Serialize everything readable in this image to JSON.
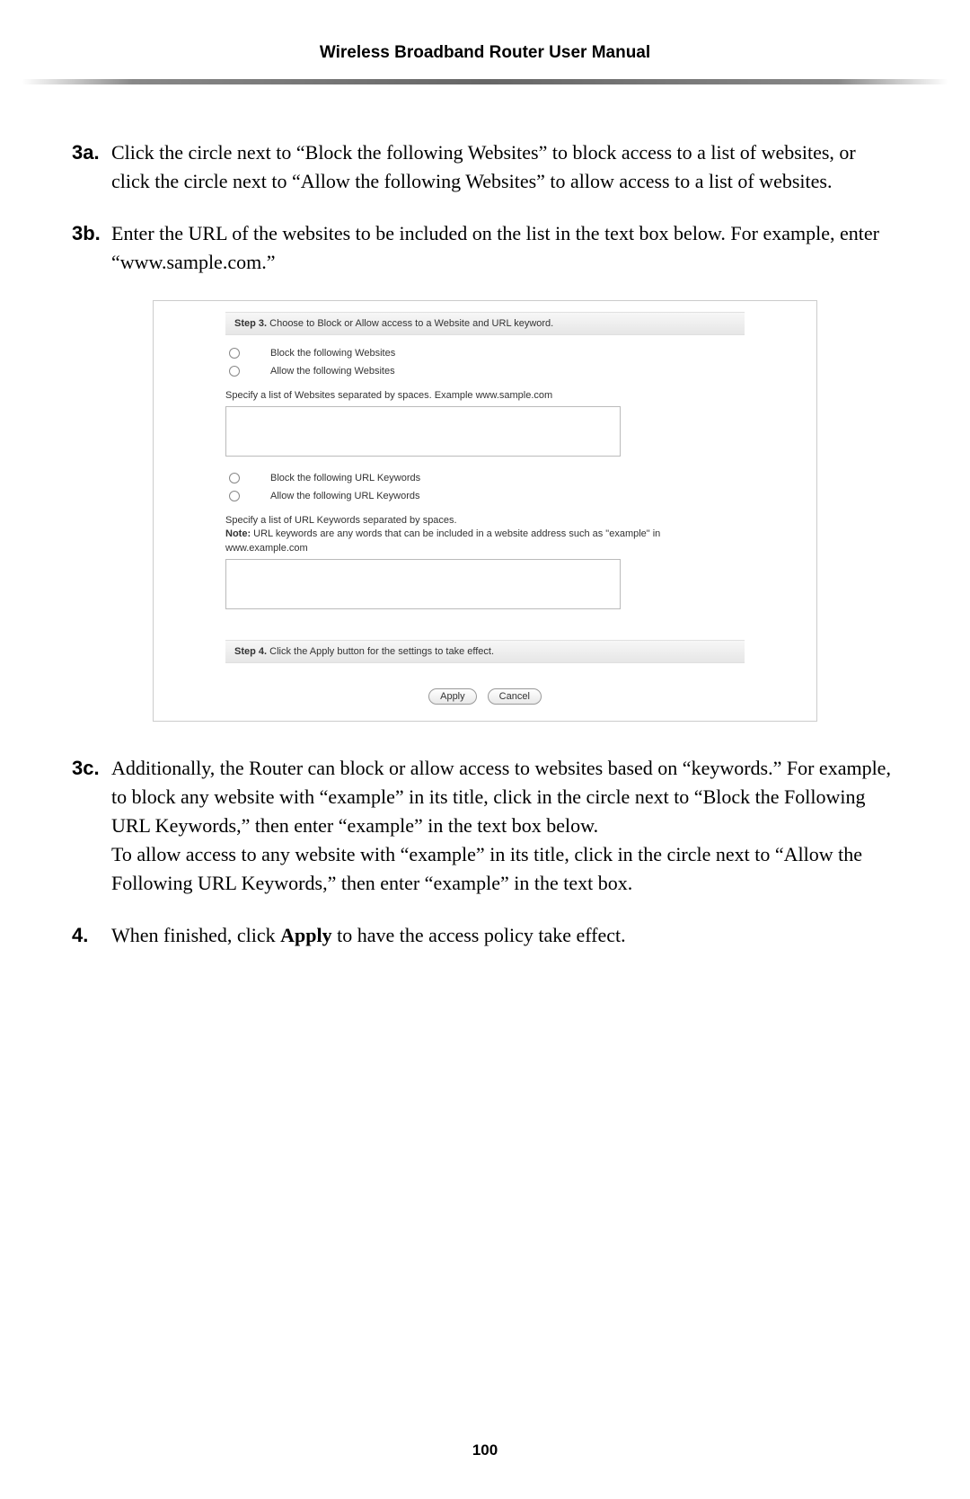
{
  "header": {
    "title": "Wireless Broadband Router User Manual"
  },
  "instructions": {
    "item3a": {
      "num": "3a.",
      "text": "Click the circle next to “Block the following Websites” to block access to a list of websites, or click the circle next to “Allow the following Websites” to allow access to a list of websites."
    },
    "item3b": {
      "num": "3b.",
      "text": "Enter the URL of the websites to be included on the list in the text box below. For example, enter “www.sample.com.”"
    },
    "item3c": {
      "num": "3c.",
      "text_p1": "Additionally, the Router can block or allow access to websites based on “keywords.” For example, to block any website with “example” in its title, click in the circle next to “Block the Following URL Keywords,” then enter “example” in the text box below.",
      "text_p2": "To allow access to any website with “example” in its title, click in the circle next to “Allow the Following URL Keywords,” then enter “example” in the text box."
    },
    "item4": {
      "num": "4.",
      "prefix": "When finished, click ",
      "bold": "Apply",
      "suffix": " to have the access policy take effect."
    }
  },
  "screenshot": {
    "step3_label": "Step 3.",
    "step3_text": " Choose to Block or Allow access to a Website and URL keyword.",
    "radios": {
      "block_websites": "Block the following Websites",
      "allow_websites": "Allow the following Websites",
      "block_keywords": "Block the following URL Keywords",
      "allow_keywords": "Allow the following URL Keywords"
    },
    "spec_websites": "Specify a list of Websites separated by spaces. Example www.sample.com",
    "spec_keywords_line1": "Specify a list of URL Keywords separated by spaces.",
    "spec_keywords_note_label": "Note:",
    "spec_keywords_note_text": " URL keywords are any words that can be included in a website address such as \"example\" in www.example.com",
    "step4_label": "Step 4.",
    "step4_text": " Click the Apply button for the settings to take effect.",
    "apply": "Apply",
    "cancel": "Cancel"
  },
  "page_number": "100"
}
